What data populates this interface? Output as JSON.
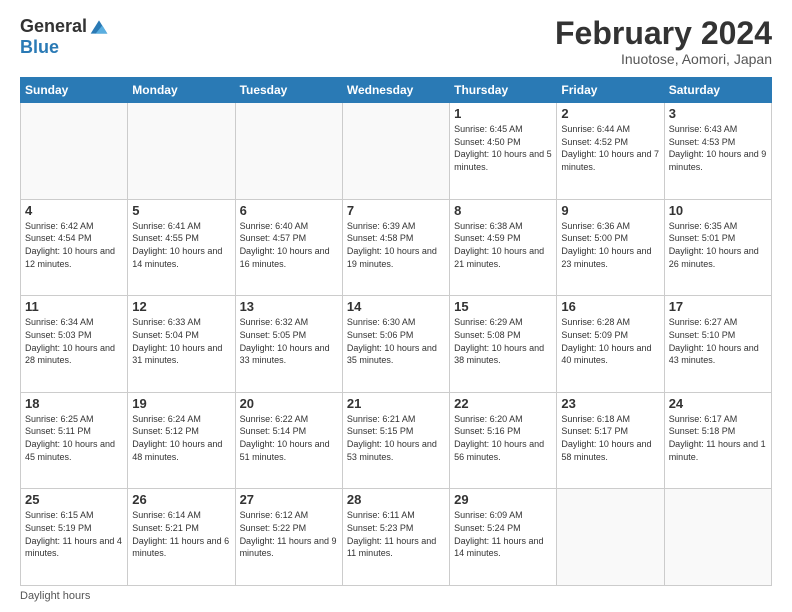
{
  "logo": {
    "general": "General",
    "blue": "Blue"
  },
  "header": {
    "month": "February 2024",
    "location": "Inuotose, Aomori, Japan"
  },
  "days_of_week": [
    "Sunday",
    "Monday",
    "Tuesday",
    "Wednesday",
    "Thursday",
    "Friday",
    "Saturday"
  ],
  "weeks": [
    [
      {
        "day": "",
        "info": ""
      },
      {
        "day": "",
        "info": ""
      },
      {
        "day": "",
        "info": ""
      },
      {
        "day": "",
        "info": ""
      },
      {
        "day": "1",
        "info": "Sunrise: 6:45 AM\nSunset: 4:50 PM\nDaylight: 10 hours\nand 5 minutes."
      },
      {
        "day": "2",
        "info": "Sunrise: 6:44 AM\nSunset: 4:52 PM\nDaylight: 10 hours\nand 7 minutes."
      },
      {
        "day": "3",
        "info": "Sunrise: 6:43 AM\nSunset: 4:53 PM\nDaylight: 10 hours\nand 9 minutes."
      }
    ],
    [
      {
        "day": "4",
        "info": "Sunrise: 6:42 AM\nSunset: 4:54 PM\nDaylight: 10 hours\nand 12 minutes."
      },
      {
        "day": "5",
        "info": "Sunrise: 6:41 AM\nSunset: 4:55 PM\nDaylight: 10 hours\nand 14 minutes."
      },
      {
        "day": "6",
        "info": "Sunrise: 6:40 AM\nSunset: 4:57 PM\nDaylight: 10 hours\nand 16 minutes."
      },
      {
        "day": "7",
        "info": "Sunrise: 6:39 AM\nSunset: 4:58 PM\nDaylight: 10 hours\nand 19 minutes."
      },
      {
        "day": "8",
        "info": "Sunrise: 6:38 AM\nSunset: 4:59 PM\nDaylight: 10 hours\nand 21 minutes."
      },
      {
        "day": "9",
        "info": "Sunrise: 6:36 AM\nSunset: 5:00 PM\nDaylight: 10 hours\nand 23 minutes."
      },
      {
        "day": "10",
        "info": "Sunrise: 6:35 AM\nSunset: 5:01 PM\nDaylight: 10 hours\nand 26 minutes."
      }
    ],
    [
      {
        "day": "11",
        "info": "Sunrise: 6:34 AM\nSunset: 5:03 PM\nDaylight: 10 hours\nand 28 minutes."
      },
      {
        "day": "12",
        "info": "Sunrise: 6:33 AM\nSunset: 5:04 PM\nDaylight: 10 hours\nand 31 minutes."
      },
      {
        "day": "13",
        "info": "Sunrise: 6:32 AM\nSunset: 5:05 PM\nDaylight: 10 hours\nand 33 minutes."
      },
      {
        "day": "14",
        "info": "Sunrise: 6:30 AM\nSunset: 5:06 PM\nDaylight: 10 hours\nand 35 minutes."
      },
      {
        "day": "15",
        "info": "Sunrise: 6:29 AM\nSunset: 5:08 PM\nDaylight: 10 hours\nand 38 minutes."
      },
      {
        "day": "16",
        "info": "Sunrise: 6:28 AM\nSunset: 5:09 PM\nDaylight: 10 hours\nand 40 minutes."
      },
      {
        "day": "17",
        "info": "Sunrise: 6:27 AM\nSunset: 5:10 PM\nDaylight: 10 hours\nand 43 minutes."
      }
    ],
    [
      {
        "day": "18",
        "info": "Sunrise: 6:25 AM\nSunset: 5:11 PM\nDaylight: 10 hours\nand 45 minutes."
      },
      {
        "day": "19",
        "info": "Sunrise: 6:24 AM\nSunset: 5:12 PM\nDaylight: 10 hours\nand 48 minutes."
      },
      {
        "day": "20",
        "info": "Sunrise: 6:22 AM\nSunset: 5:14 PM\nDaylight: 10 hours\nand 51 minutes."
      },
      {
        "day": "21",
        "info": "Sunrise: 6:21 AM\nSunset: 5:15 PM\nDaylight: 10 hours\nand 53 minutes."
      },
      {
        "day": "22",
        "info": "Sunrise: 6:20 AM\nSunset: 5:16 PM\nDaylight: 10 hours\nand 56 minutes."
      },
      {
        "day": "23",
        "info": "Sunrise: 6:18 AM\nSunset: 5:17 PM\nDaylight: 10 hours\nand 58 minutes."
      },
      {
        "day": "24",
        "info": "Sunrise: 6:17 AM\nSunset: 5:18 PM\nDaylight: 11 hours\nand 1 minute."
      }
    ],
    [
      {
        "day": "25",
        "info": "Sunrise: 6:15 AM\nSunset: 5:19 PM\nDaylight: 11 hours\nand 4 minutes."
      },
      {
        "day": "26",
        "info": "Sunrise: 6:14 AM\nSunset: 5:21 PM\nDaylight: 11 hours\nand 6 minutes."
      },
      {
        "day": "27",
        "info": "Sunrise: 6:12 AM\nSunset: 5:22 PM\nDaylight: 11 hours\nand 9 minutes."
      },
      {
        "day": "28",
        "info": "Sunrise: 6:11 AM\nSunset: 5:23 PM\nDaylight: 11 hours\nand 11 minutes."
      },
      {
        "day": "29",
        "info": "Sunrise: 6:09 AM\nSunset: 5:24 PM\nDaylight: 11 hours\nand 14 minutes."
      },
      {
        "day": "",
        "info": ""
      },
      {
        "day": "",
        "info": ""
      }
    ]
  ],
  "footer": {
    "note": "Daylight hours"
  }
}
